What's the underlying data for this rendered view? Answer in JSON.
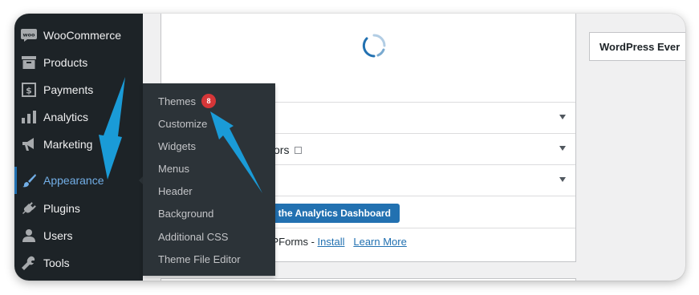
{
  "sidebar": {
    "items": [
      {
        "label": "WooCommerce",
        "icon": "woocommerce-icon"
      },
      {
        "label": "Products",
        "icon": "products-icon"
      },
      {
        "label": "Payments",
        "icon": "payments-icon"
      },
      {
        "label": "Analytics",
        "icon": "analytics-icon"
      },
      {
        "label": "Marketing",
        "icon": "marketing-icon"
      },
      {
        "label": "Appearance",
        "icon": "appearance-brush-icon"
      },
      {
        "label": "Plugins",
        "icon": "plugins-icon"
      },
      {
        "label": "Users",
        "icon": "users-icon"
      },
      {
        "label": "Tools",
        "icon": "tools-icon"
      }
    ],
    "current": "Appearance"
  },
  "submenu": {
    "items": [
      {
        "label": "Themes",
        "badge": "8"
      },
      {
        "label": "Customize"
      },
      {
        "label": "Widgets"
      },
      {
        "label": "Menus"
      },
      {
        "label": "Header"
      },
      {
        "label": "Background"
      },
      {
        "label": "Additional CSS"
      },
      {
        "label": "Theme File Editor"
      }
    ]
  },
  "main": {
    "rows": [
      {
        "text": "",
        "has_checkbox": false
      },
      {
        "text": "sitors",
        "has_checkbox": true
      },
      {
        "text": "",
        "has_checkbox": true
      }
    ],
    "analytics_button": "to the Analytics Dashboard",
    "wpforms": {
      "prefix": ": WPForms - ",
      "install": "Install",
      "learn_more": "Learn More"
    },
    "events_title": "WordPress Ever"
  },
  "colors": {
    "sidebar_bg": "#1d2327",
    "flyout_bg": "#2c3338",
    "accent": "#2271b1",
    "current_text": "#72aee6",
    "badge": "#d63638",
    "annotation_arrow": "#1a9bd7"
  }
}
